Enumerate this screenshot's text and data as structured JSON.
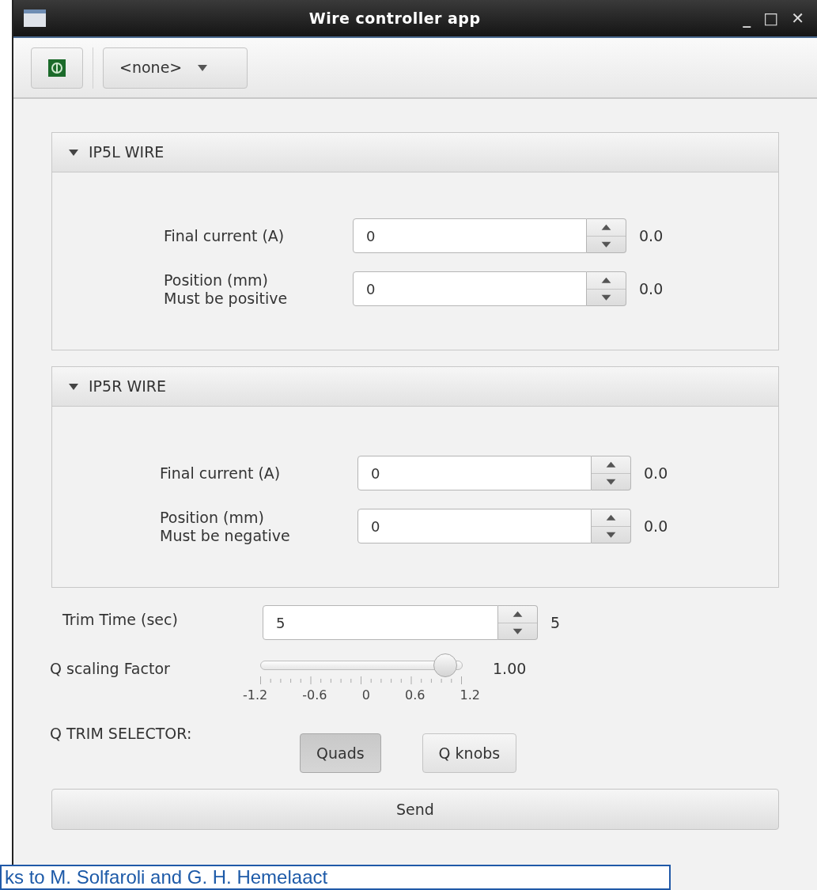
{
  "window": {
    "title": "Wire controller app",
    "controls": [
      "_",
      "□",
      "✕"
    ]
  },
  "toolbar": {
    "power_on": true,
    "dropdown": "<none>"
  },
  "sections": [
    {
      "title": "IP5L WIRE",
      "expanded": true,
      "fields": [
        {
          "label": "Final current (A)",
          "value": "0",
          "reading": "0.0"
        },
        {
          "label": "Position (mm)",
          "sublabel": "Must be positive",
          "value": "0",
          "reading": "0.0"
        }
      ]
    },
    {
      "title": "IP5R WIRE",
      "expanded": true,
      "fields": [
        {
          "label": "Final current (A)",
          "value": "0",
          "reading": "0.0"
        },
        {
          "label": "Position (mm)",
          "sublabel": "Must be negative",
          "value": "0",
          "reading": "0.0"
        }
      ]
    }
  ],
  "trim_time": {
    "label": "Trim Time (sec)",
    "value": "5",
    "reading": "5"
  },
  "q_scaling": {
    "label": "Q scaling Factor",
    "level": 0.917,
    "reading": "1.00",
    "ticks": [
      "-1.2",
      "-0.6",
      "0",
      "0.6",
      "1.2"
    ]
  },
  "q_trim_selector": {
    "label": "Q TRIM SELECTOR:",
    "options": [
      {
        "label": "Quads",
        "selected": true
      },
      {
        "label": "Q knobs",
        "selected": false
      }
    ]
  },
  "send_button": "Send",
  "caption": "ks to M. Solfaroli and G. H. Hemelaact"
}
